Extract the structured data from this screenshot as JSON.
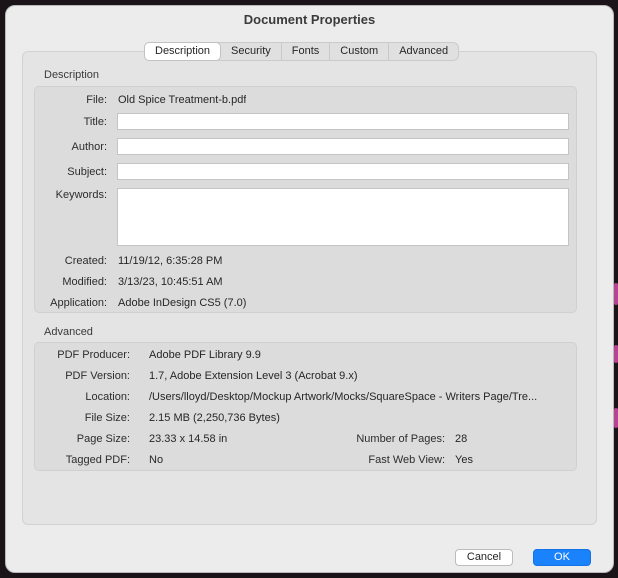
{
  "dialog": {
    "title": "Document Properties"
  },
  "tabs": [
    "Description",
    "Security",
    "Fonts",
    "Custom",
    "Advanced"
  ],
  "description": {
    "section_title": "Description",
    "file_label": "File:",
    "file_value": "Old Spice Treatment-b.pdf",
    "title_label": "Title:",
    "title_value": "",
    "author_label": "Author:",
    "author_value": "",
    "subject_label": "Subject:",
    "subject_value": "",
    "keywords_label": "Keywords:",
    "keywords_value": "",
    "created_label": "Created:",
    "created_value": "11/19/12, 6:35:28 PM",
    "modified_label": "Modified:",
    "modified_value": "3/13/23, 10:45:51 AM",
    "application_label": "Application:",
    "application_value": "Adobe InDesign CS5 (7.0)"
  },
  "advanced": {
    "section_title": "Advanced",
    "producer_label": "PDF Producer:",
    "producer_value": "Adobe PDF Library 9.9",
    "version_label": "PDF Version:",
    "version_value": "1.7, Adobe Extension Level 3 (Acrobat 9.x)",
    "location_label": "Location:",
    "location_value": "/Users/lloyd/Desktop/Mockup Artwork/Mocks/SquareSpace - Writers Page/Tre...",
    "filesize_label": "File Size:",
    "filesize_value": "2.15 MB (2,250,736 Bytes)",
    "pagesize_label": "Page Size:",
    "pagesize_value": "23.33 x 14.58 in",
    "numpages_label": "Number of Pages:",
    "numpages_value": "28",
    "tagged_label": "Tagged PDF:",
    "tagged_value": "No",
    "fastweb_label": "Fast Web View:",
    "fastweb_value": "Yes"
  },
  "buttons": {
    "cancel": "Cancel",
    "ok": "OK"
  },
  "colors": {
    "accent": "#1a82fb",
    "window_bg": "#ececec",
    "panel_bg": "#dcdcdc"
  }
}
